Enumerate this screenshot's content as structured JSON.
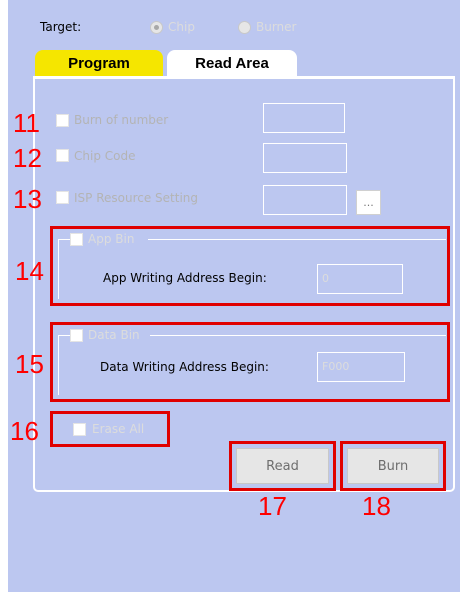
{
  "target": {
    "label": "Target:",
    "options": [
      {
        "label": "Chip",
        "selected": true
      },
      {
        "label": "Burner",
        "selected": false
      }
    ]
  },
  "tabs": [
    {
      "label": "Program",
      "active": true
    },
    {
      "label": "Read Area",
      "active": false
    }
  ],
  "fields": {
    "burn_of_number": {
      "label": "Burn of number",
      "value": ""
    },
    "chip_code": {
      "label": "Chip Code",
      "value": ""
    },
    "isp_resource": {
      "label": "ISP Resource Setting",
      "value": "",
      "browse_label": "..."
    }
  },
  "app_bin": {
    "label": "App Bin",
    "address_label": "App Writing Address Begin:",
    "address_value": "0"
  },
  "data_bin": {
    "label": "Data Bin",
    "address_label": "Data Writing Address Begin:",
    "address_value": "F000"
  },
  "erase_all": {
    "label": "Erase All"
  },
  "buttons": {
    "read": "Read",
    "burn": "Burn"
  },
  "annotations": {
    "n11": "11",
    "n12": "12",
    "n13": "13",
    "n14": "14",
    "n15": "15",
    "n16": "16",
    "n17": "17",
    "n18": "18"
  },
  "colors": {
    "background": "#bcc7f0",
    "active_tab": "#f5e600",
    "annotation": "#ff0000"
  }
}
